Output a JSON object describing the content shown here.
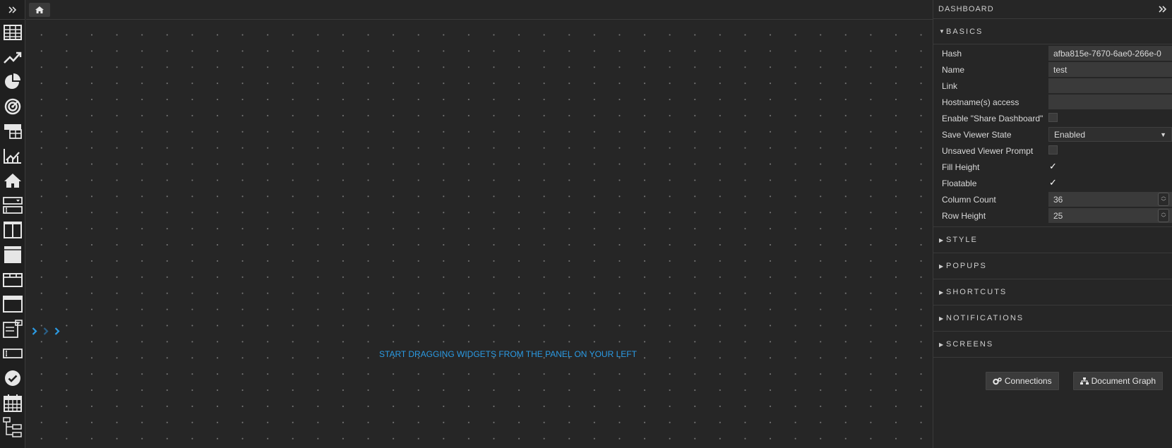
{
  "sidebar": {
    "widgets": [
      {
        "icon": "table-icon"
      },
      {
        "icon": "line-chart-icon"
      },
      {
        "icon": "pie-chart-icon"
      },
      {
        "icon": "gauge-icon"
      },
      {
        "icon": "pivot-table-icon"
      },
      {
        "icon": "combo-chart-icon"
      },
      {
        "icon": "home-icon"
      },
      {
        "icon": "form-widget-icon"
      },
      {
        "icon": "two-column-layout-icon"
      },
      {
        "icon": "row-layout-icon"
      },
      {
        "icon": "tabs-layout-icon"
      },
      {
        "icon": "window-icon"
      },
      {
        "icon": "dropdown-widget-icon"
      },
      {
        "icon": "text-input-icon"
      },
      {
        "icon": "checkmark-circle-icon"
      },
      {
        "icon": "calendar-icon"
      },
      {
        "icon": "tree-icon"
      }
    ]
  },
  "canvas": {
    "hint": "START DRAGGING WIDGETS FROM THE PANEL ON YOUR LEFT"
  },
  "panel": {
    "title": "DASHBOARD",
    "basics": {
      "title": "BASICS",
      "hash_label": "Hash",
      "hash_value": "afba815e-7670-6ae0-266e-0",
      "name_label": "Name",
      "name_value": "test",
      "link_label": "Link",
      "link_value": "",
      "hostname_label": "Hostname(s) access",
      "hostname_value": "",
      "share_label": "Enable \"Share Dashboard\"",
      "save_state_label": "Save Viewer State",
      "save_state_value": "Enabled",
      "unsaved_label": "Unsaved Viewer Prompt",
      "fill_height_label": "Fill Height",
      "floatable_label": "Floatable",
      "column_count_label": "Column Count",
      "column_count_value": "36",
      "row_height_label": "Row Height",
      "row_height_value": "25",
      "check_mark": "✓"
    },
    "sections": [
      "STYLE",
      "POPUPS",
      "SHORTCUTS",
      "NOTIFICATIONS",
      "SCREENS"
    ],
    "buttons": {
      "connections": "Connections",
      "document_graph": "Document Graph"
    }
  },
  "colors": {
    "accent": "#2b9be4",
    "background": "#272727",
    "panel_input": "#3a3a3a"
  }
}
